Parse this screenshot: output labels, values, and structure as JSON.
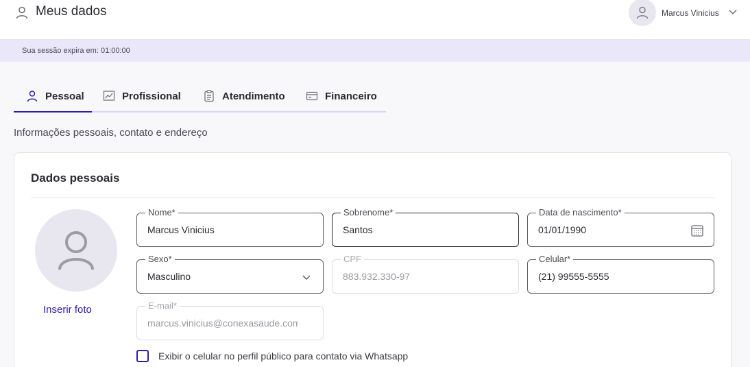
{
  "header": {
    "page_title": "Meus dados",
    "user_name": "Marcus Vinicius"
  },
  "session": {
    "text": "Sua sessão expira em: 01:00:00"
  },
  "tabs": [
    {
      "label": "Pessoal",
      "active": true,
      "icon": "user-icon"
    },
    {
      "label": "Profissional",
      "active": false,
      "icon": "chart-icon"
    },
    {
      "label": "Atendimento",
      "active": false,
      "icon": "clipboard-icon"
    },
    {
      "label": "Financeiro",
      "active": false,
      "icon": "card-icon"
    }
  ],
  "section_subtitle": "Informações pessoais, contato e endereço",
  "card": {
    "title": "Dados pessoais",
    "photo_link": "Inserir foto",
    "fields": {
      "nome": {
        "label": "Nome*",
        "value": "Marcus Vinicius"
      },
      "sobrenome": {
        "label": "Sobrenome*",
        "value": "Santos"
      },
      "nascimento": {
        "label": "Data de nascimento*",
        "value": "01/01/1990"
      },
      "sexo": {
        "label": "Sexo*",
        "value": "Masculino"
      },
      "cpf": {
        "label": "CPF",
        "value": "883.932.330-97"
      },
      "celular": {
        "label": "Celular*",
        "value": "(21) 99555-5555"
      },
      "email": {
        "label": "E-mail*",
        "value": "marcus.vinicius@conexasaude.com.br"
      }
    },
    "whatsapp_checkbox": {
      "label": "Exibir o celular no perfil público para contato via Whatsapp",
      "checked": false
    }
  },
  "colors": {
    "accent": "#2b1fa8",
    "session_bg": "#ebe7fb",
    "tab_underline": "#d9d4f5"
  }
}
